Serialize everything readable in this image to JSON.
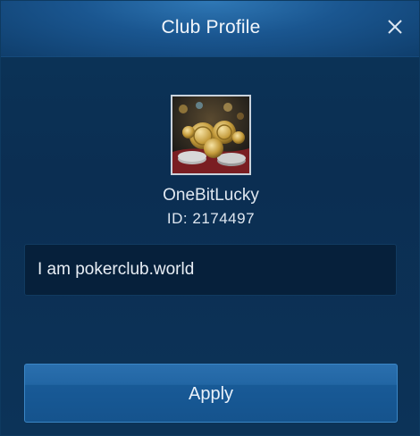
{
  "dialog": {
    "title": "Club Profile",
    "close_icon": "close-icon"
  },
  "club": {
    "avatar_icon": "club-avatar-image",
    "name": "OneBitLucky",
    "id_text": "ID: 2174497",
    "description": "I am pokerclub.world"
  },
  "actions": {
    "apply_label": "Apply"
  },
  "colors": {
    "header": "#1a5690",
    "background": "#0b2e52",
    "input_bg": "#06203b",
    "button": "#1f63a2",
    "text": "#e8eef5"
  }
}
